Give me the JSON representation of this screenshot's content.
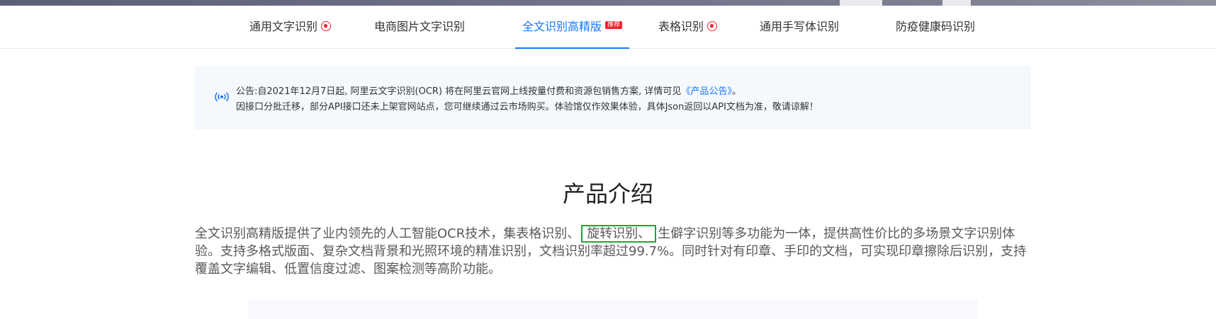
{
  "tabs": [
    {
      "label": "通用文字识别",
      "hot": true
    },
    {
      "label": "电商图片文字识别",
      "hot": false
    },
    {
      "label": "全文识别高精版",
      "badge": "推荐",
      "active": true
    },
    {
      "label": "表格识别",
      "hot": true
    },
    {
      "label": "通用手写体识别",
      "hot": false
    },
    {
      "label": "防疫健康码识别",
      "hot": false
    }
  ],
  "notice": {
    "line1_prefix": "公告:自2021年12月7日起, 阿里云文字识别(OCR) 将在阿里云官网上线按量付费和资源包销售方案, 详情可见",
    "line1_link": "《产品公告》",
    "line1_suffix": "。",
    "line2": "因接口分批迁移，部分API接口还未上架官网站点，您可继续通过云市场购买。体验馆仅作效果体验，具体Json返回以API文档为准，敬请谅解！"
  },
  "section_title": "产品介绍",
  "intro": {
    "before": "全文识别高精版提供了业内领先的人工智能OCR技术，集表格识别、",
    "highlight": "旋转识别、",
    "after": "生僻字识别等多功能为一体，提供高性价比的多场景文字识别体验。支持多格式版面、复杂文档背景和光照环境的精准识别，文档识别率超过99.7%。同时针对有印章、手印的文档，可实现印章擦除后识别，支持覆盖文字编辑、低置信度过滤、图案检测等高阶功能。"
  },
  "colors": {
    "accent": "#1677ff",
    "hot": "#f5222d",
    "highlight_border": "#23a338",
    "notice_bg": "#f5f8fd"
  }
}
